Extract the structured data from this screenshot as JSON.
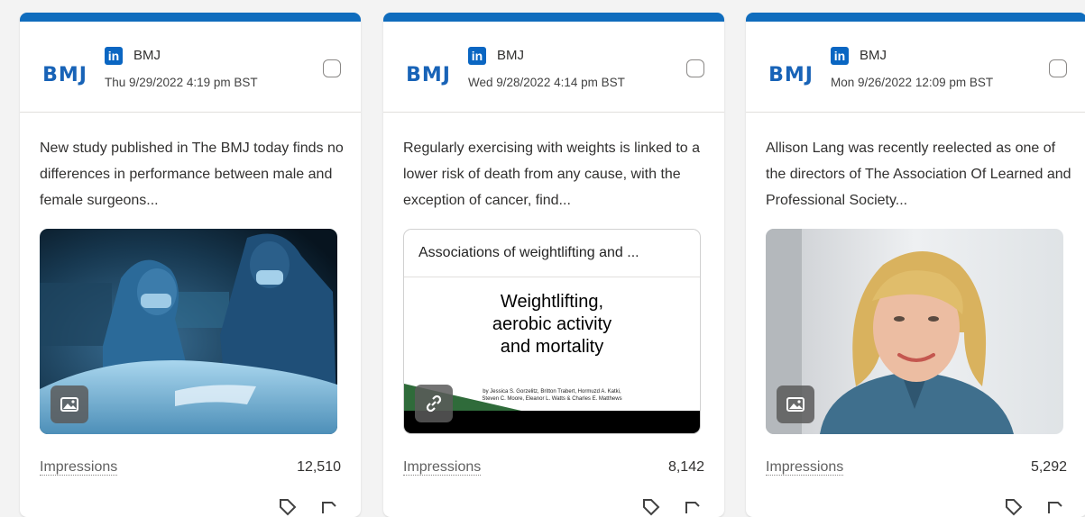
{
  "posts": [
    {
      "account": "BMJ",
      "logo_text": "BMJ",
      "network_icon": "in",
      "date": "Thu 9/29/2022 4:19 pm BST",
      "text": "New study published in The BMJ today finds no differences in performance between male and female surgeons...",
      "media_type": "image",
      "media_icon": "image-icon",
      "impressions_label": "Impressions",
      "impressions_value": "12,510"
    },
    {
      "account": "BMJ",
      "logo_text": "BMJ",
      "network_icon": "in",
      "date": "Wed 9/28/2022 4:14 pm BST",
      "text": "Regularly exercising with weights is linked to a lower risk of death from any cause, with the exception of cancer, find...",
      "media_type": "link",
      "media_icon": "link-icon",
      "link_title": "Associations of weightlifting and ...",
      "cover_title_lines": [
        "Weightlifting,",
        "aerobic activity",
        "and mortality"
      ],
      "cover_authors_lines": [
        "by Jessica S. Gorzelitz, Britton Trabert, Hormuzd A. Katki,",
        "Steven C. Moore, Eleanor L. Watts & Charles E. Matthews"
      ],
      "impressions_label": "Impressions",
      "impressions_value": "8,142"
    },
    {
      "account": "BMJ",
      "logo_text": "BMJ",
      "network_icon": "in",
      "date": "Mon 9/26/2022 12:09 pm BST",
      "text": "Allison Lang was recently reelected as one of the directors of The Association Of Learned and Professional Society...",
      "media_type": "image",
      "media_icon": "image-icon",
      "impressions_label": "Impressions",
      "impressions_value": "5,292"
    }
  ],
  "colors": {
    "accent_bar": "#0f6cbd",
    "linkedin": "#0a66c2",
    "bmj_blue": "#1863b7"
  }
}
